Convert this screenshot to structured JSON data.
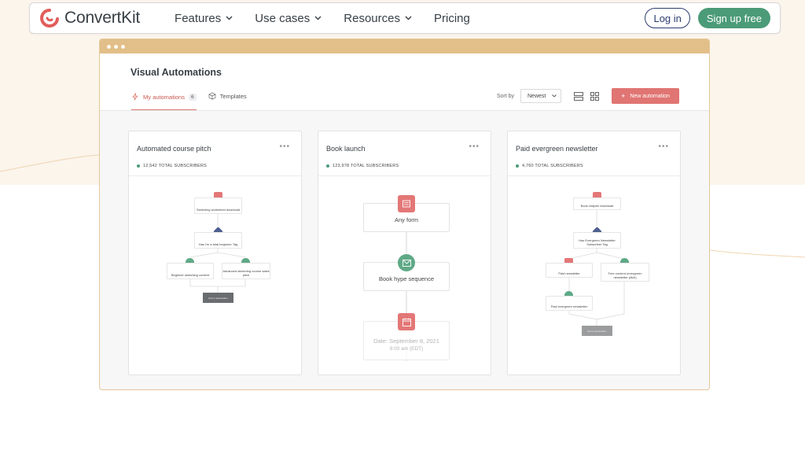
{
  "nav": {
    "brand": "ConvertKit",
    "menu": [
      {
        "label": "Features",
        "dropdown": true
      },
      {
        "label": "Use cases",
        "dropdown": true
      },
      {
        "label": "Resources",
        "dropdown": true
      },
      {
        "label": "Pricing",
        "dropdown": false
      }
    ],
    "login_label": "Log in",
    "signup_label": "Sign up free"
  },
  "app": {
    "title": "Visual Automations",
    "tabs": [
      {
        "label": "My automations",
        "count": "6",
        "active": true,
        "icon": "lightning-icon"
      },
      {
        "label": "Templates",
        "active": false,
        "icon": "cube-icon"
      }
    ],
    "sort_label": "Sort by",
    "sort_value": "Newest",
    "new_button": "New automation"
  },
  "cards": [
    {
      "title": "Automated course pitch",
      "subscribers": "12,542 TOTAL SUBSCRIBERS",
      "steps": [
        "Sketching worksheet download",
        "Has I'm a total beginner Tag",
        "Beginner sketching content",
        "Advanced sketching course sales pitch",
        "Exit or automation"
      ]
    },
    {
      "title": "Book launch",
      "subscribers": "123,978 TOTAL SUBSCRIBERS",
      "steps": [
        "Any form",
        "Book hype sequence",
        "Date: September 8, 2021",
        "9:00 am (EDT)"
      ]
    },
    {
      "title": "Paid evergreen newsletter",
      "subscribers": "4,760 TOTAL SUBSCRIBERS",
      "steps": [
        "Book chapter download",
        "Has Evergreen Newsletter Subscriber Tag",
        "Paid newsletter",
        "Free content (evergreen newsletter pitch)",
        "Paid evergreen newsletter",
        "Exit or automation"
      ]
    }
  ],
  "colors": {
    "brand_red": "#e25e5a",
    "green": "#4b9b78",
    "navy": "#2b3e6e",
    "window_bar": "#e2bf88",
    "accent_button": "#e07573"
  }
}
